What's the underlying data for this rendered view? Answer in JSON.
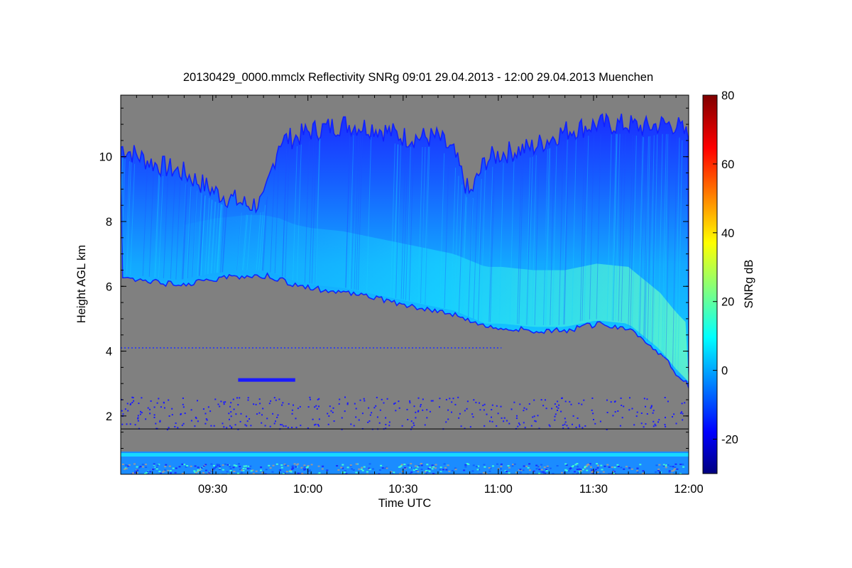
{
  "chart_data": {
    "type": "heatmap",
    "title": "20130429_0000.mmclx Reflectivity SNRg   09:01 29.04.2013 - 12:00 29.04.2013 Muenchen",
    "xlabel": "Time UTC",
    "ylabel": "Height AGL km",
    "x_range": [
      "09:01",
      "12:00"
    ],
    "ylim": [
      0.2,
      11.9
    ],
    "x_ticks": [
      "09:30",
      "10:00",
      "10:30",
      "11:00",
      "11:30",
      "12:00"
    ],
    "x_tick_minutes": [
      29,
      59,
      89,
      119,
      149,
      179
    ],
    "x_span_minutes": 179,
    "y_ticks": [
      2,
      4,
      6,
      8,
      10
    ],
    "colorbar": {
      "label": "SNRg dB",
      "range": [
        -30,
        80
      ],
      "ticks": [
        -20,
        0,
        20,
        40,
        60,
        80
      ],
      "colormap": "jet"
    },
    "no_data_color": "#808080",
    "separator_height_km": 1.6,
    "cloud_layer": {
      "times_min": [
        0,
        10,
        20,
        30,
        40,
        45,
        50,
        55,
        60,
        70,
        80,
        90,
        100,
        105,
        110,
        115,
        120,
        130,
        140,
        150,
        160,
        165,
        170,
        175,
        179
      ],
      "top_km": [
        10.3,
        9.8,
        9.5,
        8.9,
        8.5,
        8.6,
        10.5,
        10.6,
        10.8,
        11.0,
        10.9,
        10.6,
        10.6,
        10.1,
        8.8,
        9.9,
        10.1,
        10.3,
        10.8,
        11.0,
        11.0,
        10.9,
        11.0,
        11.0,
        10.6
      ],
      "base_km": [
        6.2,
        6.1,
        6.0,
        6.2,
        6.3,
        6.3,
        6.2,
        6.0,
        5.9,
        5.8,
        5.6,
        5.4,
        5.2,
        5.1,
        4.9,
        4.7,
        4.7,
        4.6,
        4.6,
        4.8,
        4.7,
        4.3,
        3.9,
        3.3,
        2.9
      ],
      "core_snr_db": [
        -5,
        5,
        8,
        12,
        14
      ]
    },
    "near_surface_layer": {
      "top_km": 0.9,
      "base_km": 0.2
    },
    "clutter_line_km": 4.1,
    "small_echo": {
      "time_min": [
        37,
        55
      ],
      "height_km": 3.1
    }
  }
}
